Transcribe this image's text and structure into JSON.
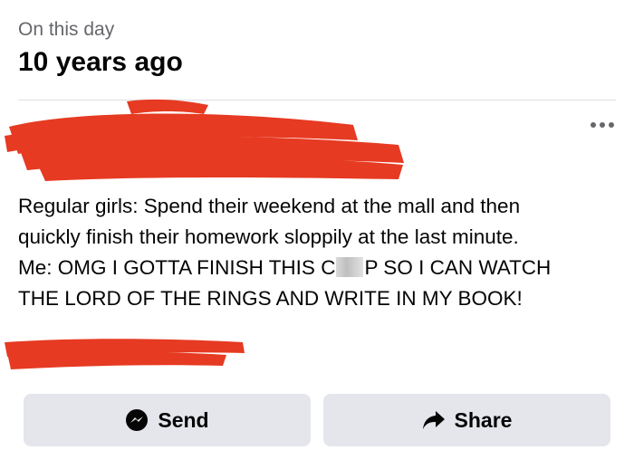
{
  "header": {
    "subtitle": "On this day",
    "title": "10 years ago"
  },
  "post": {
    "lines": [
      "Regular girls: Spend their weekend at the mall and then",
      "quickly finish their homework sloppily at the last minute.",
      "Me: OMG I GOTTA FINISH THIS C",
      "P SO I CAN WATCH",
      "THE LORD OF THE RINGS AND WRITE IN MY BOOK!"
    ]
  },
  "actions": {
    "send_label": "Send",
    "share_label": "Share",
    "send_icon": "messenger-icon",
    "share_icon": "share-arrow-icon",
    "more_icon": "more-options-icon"
  },
  "colors": {
    "redaction": "#e63a22",
    "button_bg": "#e4e6eb",
    "secondary_text": "#65676b"
  }
}
